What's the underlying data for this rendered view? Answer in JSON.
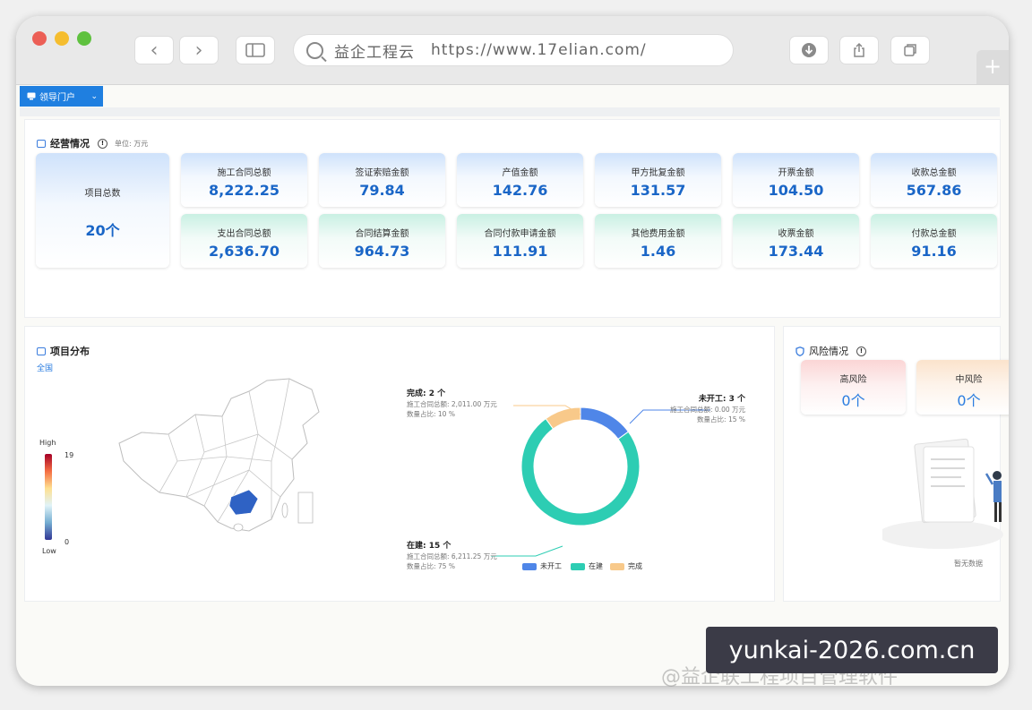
{
  "browser": {
    "site_name": "益企工程云",
    "url": "https://www.17elian.com/"
  },
  "portal": {
    "label": "领导门户"
  },
  "business": {
    "title": "经营情况",
    "unit": "单位: 万元",
    "total": {
      "label": "项目总数",
      "value": "20个"
    },
    "row1": [
      {
        "label": "施工合同总额",
        "value": "8,222.25"
      },
      {
        "label": "签证索赔金额",
        "value": "79.84"
      },
      {
        "label": "产值金额",
        "value": "142.76"
      },
      {
        "label": "甲方批复金额",
        "value": "131.57"
      },
      {
        "label": "开票金额",
        "value": "104.50"
      },
      {
        "label": "收款总金额",
        "value": "567.86"
      }
    ],
    "row2": [
      {
        "label": "支出合同总额",
        "value": "2,636.70"
      },
      {
        "label": "合同结算金额",
        "value": "964.73"
      },
      {
        "label": "合同付款申请金额",
        "value": "111.91"
      },
      {
        "label": "其他费用金额",
        "value": "1.46"
      },
      {
        "label": "收票金额",
        "value": "173.44"
      },
      {
        "label": "付款总金额",
        "value": "91.16"
      }
    ]
  },
  "distribution": {
    "title": "项目分布",
    "scope": "全国",
    "scale": {
      "high_label": "High",
      "low_label": "Low",
      "max": "19",
      "min": "0"
    }
  },
  "chart_data": {
    "type": "pie",
    "categories": [
      "未开工",
      "在建",
      "完成"
    ],
    "values": [
      3,
      15,
      2
    ],
    "colors": [
      "#4f86e8",
      "#2dcdb3",
      "#f8c98a"
    ],
    "annotations": [
      {
        "title": "未开工: 3 个",
        "line1": "施工合同总额: 0.00 万元",
        "line2": "数量占比: 15 %"
      },
      {
        "title": "在建: 15 个",
        "line1": "施工合同总额: 6,211.25 万元",
        "line2": "数量占比: 75 %"
      },
      {
        "title": "完成: 2 个",
        "line1": "施工合同总额: 2,011.00 万元",
        "line2": "数量占比: 10 %"
      }
    ],
    "legend_position": "bottom"
  },
  "risk": {
    "title": "风险情况",
    "cards": [
      {
        "label": "高风险",
        "value": "0个"
      },
      {
        "label": "中风险",
        "value": "0个"
      }
    ],
    "empty_text": "暂无数据"
  },
  "watermark": {
    "box_text": "yunkai-2026.com.cn",
    "overlay_text": "@益企联工程项目管理软件"
  }
}
